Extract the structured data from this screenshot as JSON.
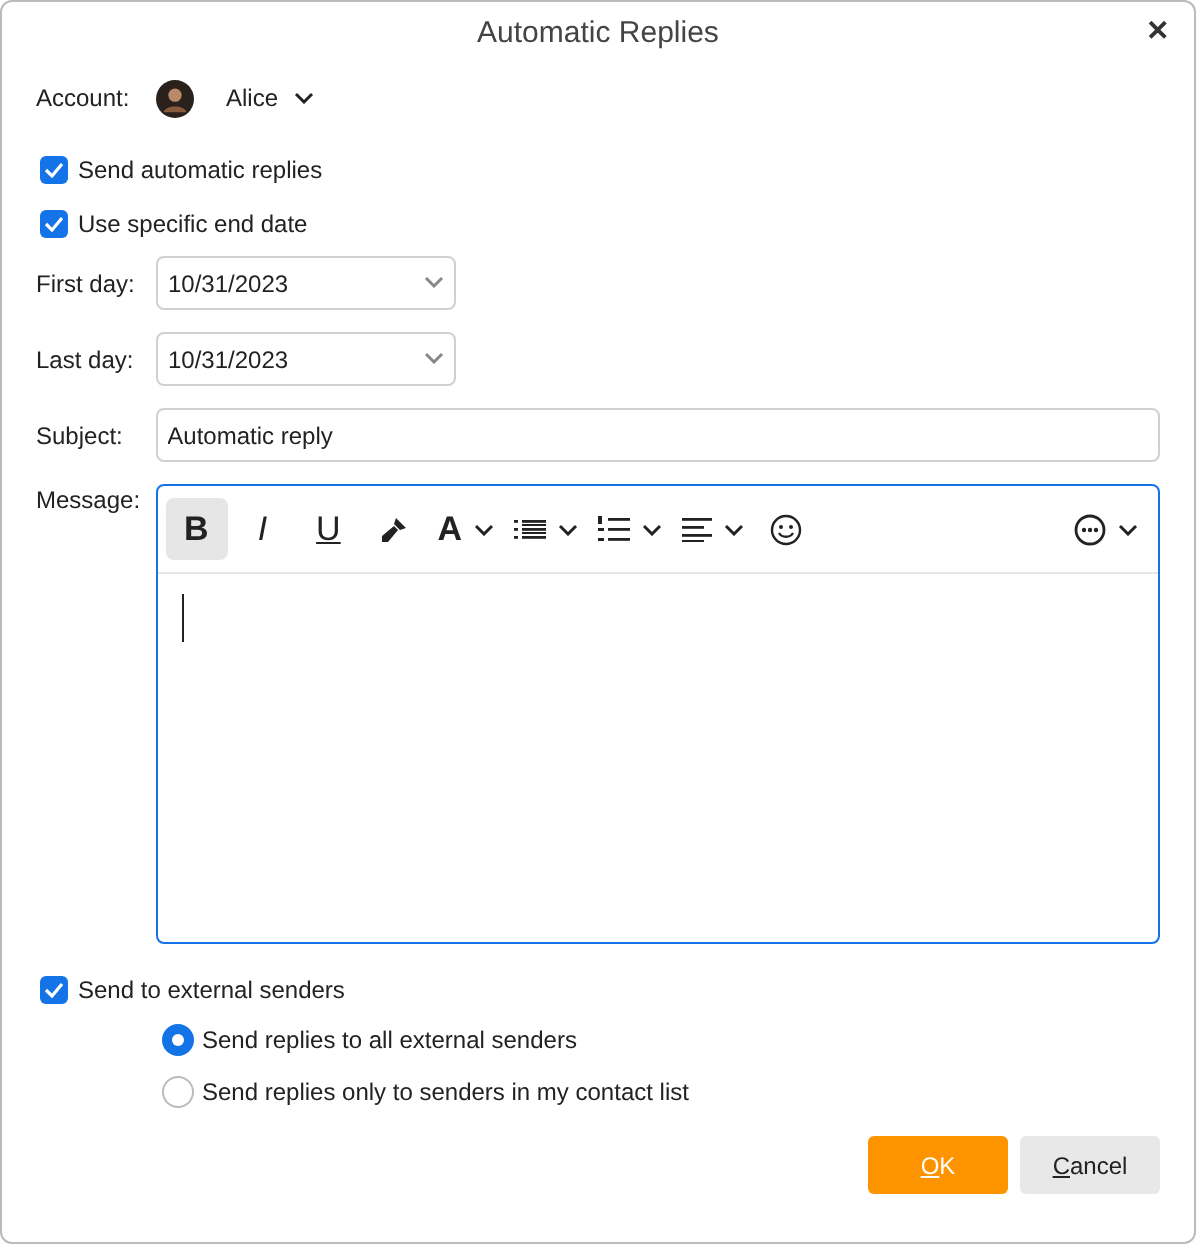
{
  "window": {
    "title": "Automatic Replies",
    "close": "✕"
  },
  "account": {
    "label": "Account:",
    "name": "Alice"
  },
  "options": [
    {
      "label": "Send automatic replies",
      "checked": true
    },
    {
      "label": "Use specific end date",
      "checked": true
    }
  ],
  "dates": [
    {
      "label": "First day:",
      "value": "10/31/2023"
    },
    {
      "label": "Last day:",
      "value": "10/31/2023"
    }
  ],
  "subject": {
    "label": "Subject:",
    "value": "Automatic reply"
  },
  "message": {
    "label": "Message:",
    "toolbar": [
      {
        "kind": "bold",
        "label": "B",
        "selected": true,
        "dropdown": false
      },
      {
        "kind": "italic",
        "label": "I",
        "selected": false,
        "dropdown": false
      },
      {
        "kind": "underline",
        "label": "U",
        "selected": false,
        "dropdown": false
      },
      {
        "kind": "brush",
        "selected": false,
        "dropdown": false
      },
      {
        "kind": "font-color",
        "label": "A",
        "selected": false,
        "dropdown": true
      },
      {
        "kind": "bullets",
        "selected": false,
        "dropdown": true
      },
      {
        "kind": "numbers",
        "selected": false,
        "dropdown": true
      },
      {
        "kind": "align",
        "selected": false,
        "dropdown": true
      },
      {
        "kind": "emoji",
        "selected": false,
        "dropdown": false
      },
      {
        "kind": "spacer"
      },
      {
        "kind": "more",
        "selected": false,
        "dropdown": true
      }
    ]
  },
  "external": {
    "label": "Send to external senders",
    "checked": true,
    "choices": [
      {
        "label": "Send replies to all external senders",
        "selected": true
      },
      {
        "label": "Send replies only to senders in my contact list",
        "selected": false
      }
    ]
  },
  "buttons": [
    {
      "label": "OK",
      "kind": "primary"
    },
    {
      "label": "Cancel",
      "kind": "secondary"
    }
  ]
}
